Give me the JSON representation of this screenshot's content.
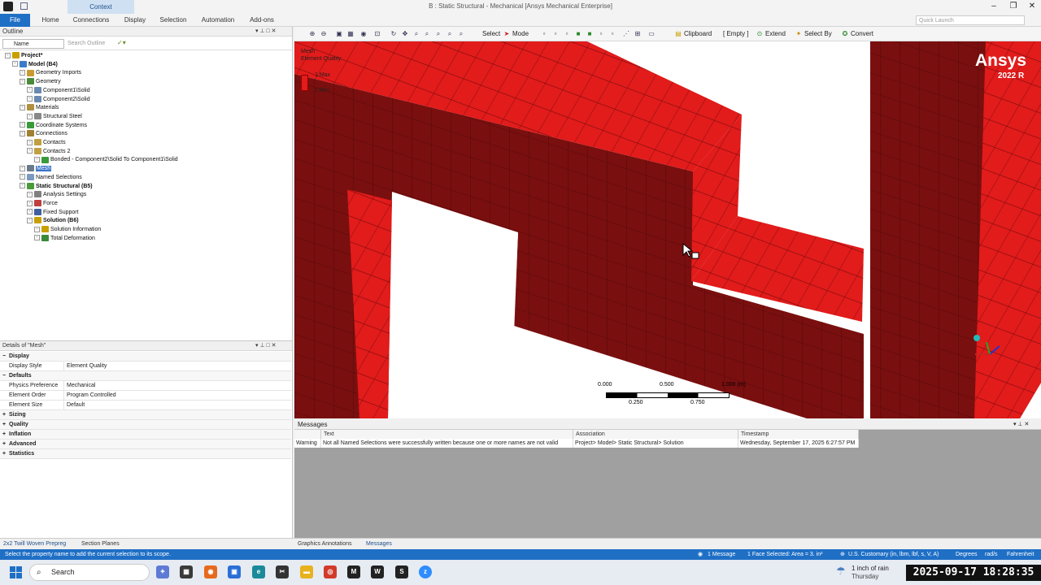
{
  "window": {
    "title": "B : Static Structural - Mechanical [Ansys Mechanical Enterprise]",
    "context_tab": "Context"
  },
  "ribbon": {
    "tabs": [
      "File",
      "Home",
      "Connections",
      "Display",
      "Selection",
      "Automation",
      "Add-ons"
    ],
    "quick_launch_placeholder": "Quick Launch"
  },
  "outline": {
    "title": "Outline",
    "name_filter": "Name",
    "search_placeholder": "Search Outline",
    "tree": [
      {
        "label": "Project*",
        "level": 0,
        "icon": "project-icon",
        "bold": true
      },
      {
        "label": "Model (B4)",
        "level": 1,
        "icon": "model-icon",
        "bold": true
      },
      {
        "label": "Geometry Imports",
        "level": 2,
        "icon": "geometry-imports-icon"
      },
      {
        "label": "Geometry",
        "level": 2,
        "icon": "geometry-icon"
      },
      {
        "label": "Component1\\Solid",
        "level": 3,
        "icon": "solid-icon"
      },
      {
        "label": "Component2\\Solid",
        "level": 3,
        "icon": "solid-icon"
      },
      {
        "label": "Materials",
        "level": 2,
        "icon": "materials-icon"
      },
      {
        "label": "Structural Steel",
        "level": 3,
        "icon": "material-icon"
      },
      {
        "label": "Coordinate Systems",
        "level": 2,
        "icon": "coordinate-systems-icon"
      },
      {
        "label": "Connections",
        "level": 2,
        "icon": "connections-icon"
      },
      {
        "label": "Contacts",
        "level": 3,
        "icon": "contacts-icon"
      },
      {
        "label": "Contacts 2",
        "level": 3,
        "icon": "contacts-icon"
      },
      {
        "label": "Bonded - Component2\\Solid To Component1\\Solid",
        "level": 4,
        "icon": "bonded-contact-icon"
      },
      {
        "label": "Mesh",
        "level": 2,
        "icon": "mesh-icon",
        "selected": true
      },
      {
        "label": "Named Selections",
        "level": 2,
        "icon": "named-selections-icon"
      },
      {
        "label": "Static Structural (B5)",
        "level": 2,
        "icon": "static-structural-icon",
        "bold": true
      },
      {
        "label": "Analysis Settings",
        "level": 3,
        "icon": "analysis-settings-icon"
      },
      {
        "label": "Force",
        "level": 3,
        "icon": "force-icon"
      },
      {
        "label": "Fixed Support",
        "level": 3,
        "icon": "fixed-support-icon"
      },
      {
        "label": "Solution (B6)",
        "level": 3,
        "icon": "solution-icon",
        "bold": true
      },
      {
        "label": "Solution Information",
        "level": 4,
        "icon": "solution-information-icon"
      },
      {
        "label": "Total Deformation",
        "level": 4,
        "icon": "total-deformation-icon"
      }
    ]
  },
  "details": {
    "title": "Details of \"Mesh\"",
    "rows": [
      {
        "type": "group",
        "label": "Display"
      },
      {
        "type": "prop",
        "label": "Display Style",
        "value": "Element Quality"
      },
      {
        "type": "group",
        "label": "Defaults"
      },
      {
        "type": "prop",
        "label": "Physics Preference",
        "value": "Mechanical"
      },
      {
        "type": "prop",
        "label": "Element Order",
        "value": "Program Controlled"
      },
      {
        "type": "prop",
        "label": "Element Size",
        "value": "Default"
      },
      {
        "type": "group",
        "label": "Sizing"
      },
      {
        "type": "group",
        "label": "Quality"
      },
      {
        "type": "group",
        "label": "Inflation"
      },
      {
        "type": "group",
        "label": "Advanced"
      },
      {
        "type": "group",
        "label": "Statistics"
      }
    ]
  },
  "toolbar": {
    "select": "Select",
    "mode": "Mode",
    "clipboard": "Clipboard",
    "empty": "[ Empty ]",
    "extend": "Extend",
    "select_by": "Select By",
    "convert": "Convert"
  },
  "viewport": {
    "legend_title": "Mesh",
    "legend_subtitle": "Element Quality",
    "legend_max": "1 Max",
    "legend_min": "1 Min",
    "brand": "Ansys",
    "version": "2022 R",
    "scale_top": [
      "0.000",
      "0.500",
      "1.000 (m)"
    ],
    "scale_bottom": [
      "0.250",
      "0.750"
    ],
    "colors": {
      "face_light": "#e21b1b",
      "face_dark": "#7a0f0f",
      "edge": "#4a0808"
    }
  },
  "messages": {
    "title": "Messages",
    "columns": [
      "Text",
      "Association",
      "Timestamp"
    ],
    "rows": [
      {
        "type": "Warning",
        "text": "Not all Named Selections were successfully written because one or more names are not valid",
        "association": "Project> Model> Static Structural> Solution",
        "timestamp": "Wednesday, September 17, 2025 6:27:57 PM"
      }
    ]
  },
  "bottom_tabs": {
    "left": [
      "2x2 Twill Woven Prepreg",
      "Section Planes"
    ],
    "right": [
      "Graphics Annotations",
      "Messages"
    ]
  },
  "statusbar": {
    "hint": "Select the property name to add the current selection to its scope.",
    "messages": "1 Message",
    "selection": "1 Face Selected: Area = 3. in²",
    "units": "U.S. Customary (in, lbm, lbf, s, V, A)",
    "angle": "Degrees",
    "rate": "rad/s",
    "temperature": "Fahrenheit"
  },
  "taskbar": {
    "search": "Search",
    "weather_line1": "1 inch of rain",
    "weather_line2": "Thursday",
    "clock": "2025-09-17 18:28:35"
  }
}
